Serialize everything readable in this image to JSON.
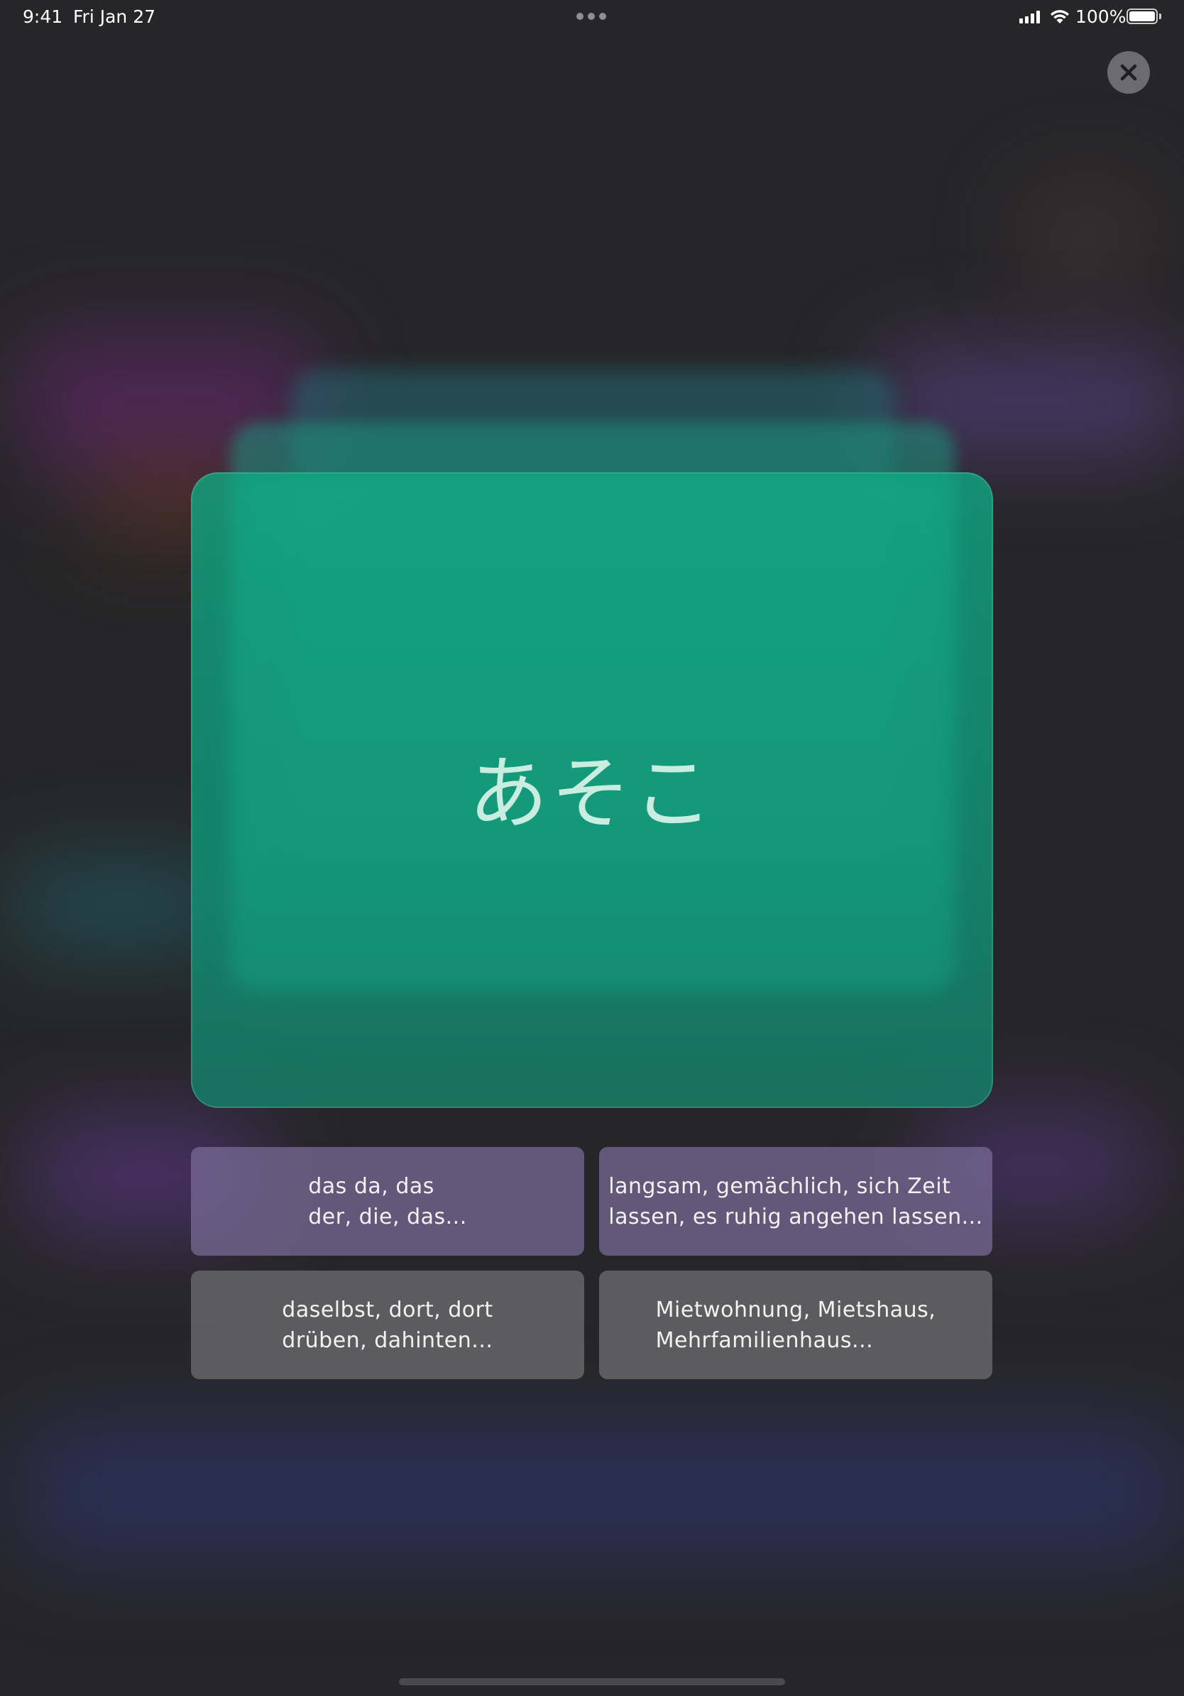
{
  "status_bar": {
    "time": "9:41",
    "date": "Fri Jan 27",
    "battery": "100%"
  },
  "close_button": {
    "icon": "close-icon"
  },
  "flashcard": {
    "word": "あそこ",
    "color": "#10a882"
  },
  "answers": [
    {
      "text": "das da, das\nder, die, das..."
    },
    {
      "text": "langsam, gemächlich, sich Zeit\nlassen, es ruhig angehen lassen..."
    },
    {
      "text": "daselbst, dort, dort\ndrüben, dahinten..."
    },
    {
      "text": "Mietwohnung, Mietshaus,\nMehrfamilienhaus..."
    }
  ]
}
